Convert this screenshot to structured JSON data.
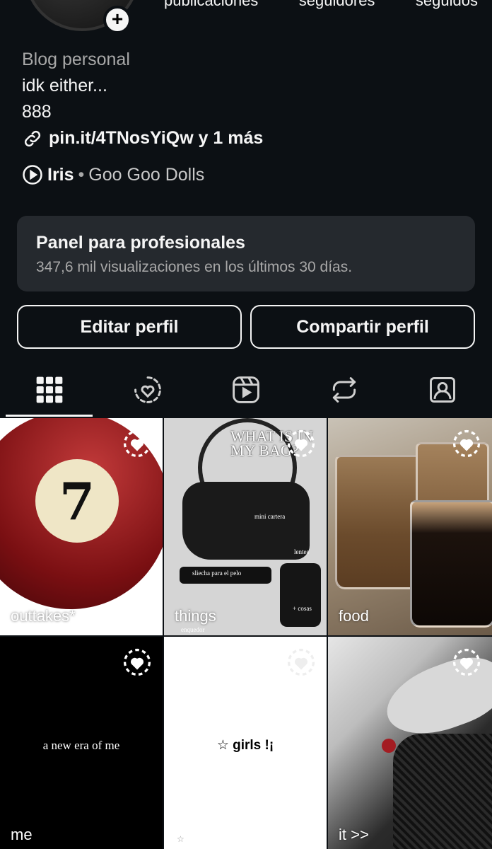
{
  "profile": {
    "stats_labels": [
      "publicaciones",
      "seguidores",
      "seguidos"
    ],
    "category": "Blog personal",
    "bio_line1": "idk either...",
    "bio_line2": "888",
    "link_text": "pin.it/4TNosYiQw y 1 más",
    "music": {
      "song": "Iris",
      "separator": "•",
      "artist": "Goo Goo Dolls"
    }
  },
  "panel": {
    "title": "Panel para profesionales",
    "subtitle": "347,6 mil visualizaciones en los últimos 30 días."
  },
  "buttons": {
    "edit": "Editar perfil",
    "share": "Compartir perfil"
  },
  "tabs": [
    "grid-icon",
    "highlights-icon",
    "reels-icon",
    "reposts-icon",
    "tagged-icon"
  ],
  "highlights": [
    {
      "label": "outtakes*"
    },
    {
      "label": "things",
      "overlay_title": "WHAT IS IN MY BAG?",
      "captions": [
        "mini cartera",
        "lentes",
        "sliecha para el pelo",
        "+ cosas",
        "enquedor"
      ]
    },
    {
      "label": "food"
    },
    {
      "label": "me",
      "center_text": "a new era of me"
    },
    {
      "label": "",
      "center_text": "☆ girls !¡",
      "corner": "☆"
    },
    {
      "label": "it >>"
    }
  ],
  "colors": {
    "background": "#0c1014",
    "panel": "#25292e",
    "text": "#f5f5f5",
    "muted": "#a8a8a8"
  }
}
